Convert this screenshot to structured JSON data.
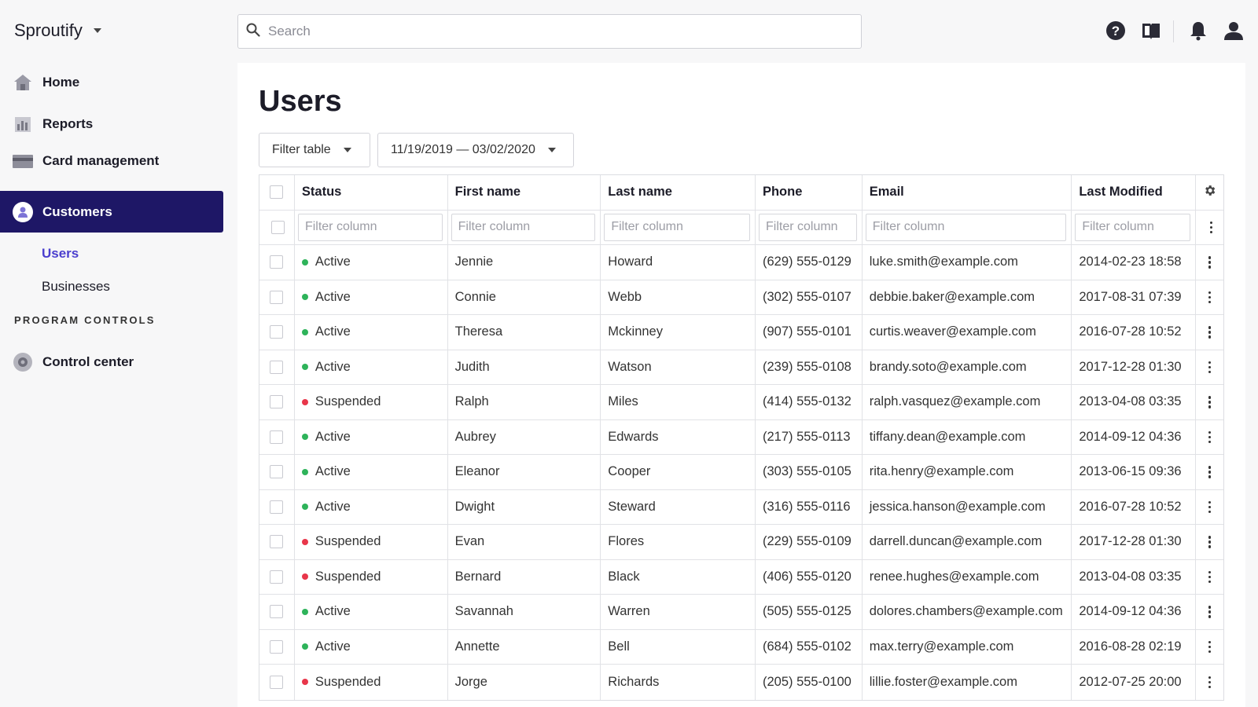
{
  "app": {
    "name": "Sproutify"
  },
  "search": {
    "placeholder": "Search"
  },
  "sidebar": {
    "items": [
      {
        "label": "Home",
        "icon": "home-icon"
      },
      {
        "label": "Reports",
        "icon": "reports-icon"
      },
      {
        "label": "Card management",
        "icon": "card-icon"
      },
      {
        "label": "Customers",
        "icon": "customers-icon",
        "active": true
      }
    ],
    "sub_items": [
      {
        "label": "Users",
        "active": true
      },
      {
        "label": "Businesses"
      }
    ],
    "section_label": "PROGRAM CONTROLS",
    "section_items": [
      {
        "label": "Control center",
        "icon": "gear-icon"
      }
    ]
  },
  "topbar": {
    "icons": [
      "help-icon",
      "book-icon",
      "bell-icon",
      "user-icon"
    ]
  },
  "main": {
    "title": "Users",
    "filter_button": "Filter table",
    "date_range": "11/19/2019 — 03/02/2020",
    "table": {
      "columns": [
        "Status",
        "First name",
        "Last name",
        "Phone",
        "Email",
        "Last Modified"
      ],
      "filter_placeholder": "Filter column",
      "rows": [
        {
          "status": "Active",
          "first": "Jennie",
          "last": "Howard",
          "phone": "(629) 555-0129",
          "email": "luke.smith@example.com",
          "modified": "2014-02-23 18:58"
        },
        {
          "status": "Active",
          "first": "Connie",
          "last": "Webb",
          "phone": "(302) 555-0107",
          "email": "debbie.baker@example.com",
          "modified": "2017-08-31 07:39"
        },
        {
          "status": "Active",
          "first": "Theresa",
          "last": "Mckinney",
          "phone": "(907) 555-0101",
          "email": "curtis.weaver@example.com",
          "modified": "2016-07-28 10:52"
        },
        {
          "status": "Active",
          "first": "Judith",
          "last": "Watson",
          "phone": "(239) 555-0108",
          "email": "brandy.soto@example.com",
          "modified": "2017-12-28 01:30"
        },
        {
          "status": "Suspended",
          "first": "Ralph",
          "last": "Miles",
          "phone": "(414) 555-0132",
          "email": "ralph.vasquez@example.com",
          "modified": "2013-04-08 03:35"
        },
        {
          "status": "Active",
          "first": "Aubrey",
          "last": "Edwards",
          "phone": "(217) 555-0113",
          "email": "tiffany.dean@example.com",
          "modified": "2014-09-12 04:36"
        },
        {
          "status": "Active",
          "first": "Eleanor",
          "last": "Cooper",
          "phone": "(303) 555-0105",
          "email": "rita.henry@example.com",
          "modified": "2013-06-15 09:36"
        },
        {
          "status": "Active",
          "first": "Dwight",
          "last": "Steward",
          "phone": "(316) 555-0116",
          "email": "jessica.hanson@example.com",
          "modified": "2016-07-28 10:52"
        },
        {
          "status": "Suspended",
          "first": "Evan",
          "last": "Flores",
          "phone": "(229) 555-0109",
          "email": "darrell.duncan@example.com",
          "modified": "2017-12-28 01:30"
        },
        {
          "status": "Suspended",
          "first": "Bernard",
          "last": "Black",
          "phone": "(406) 555-0120",
          "email": "renee.hughes@example.com",
          "modified": "2013-04-08 03:35"
        },
        {
          "status": "Active",
          "first": "Savannah",
          "last": "Warren",
          "phone": "(505) 555-0125",
          "email": "dolores.chambers@example.com",
          "modified": "2014-09-12 04:36"
        },
        {
          "status": "Active",
          "first": "Annette",
          "last": "Bell",
          "phone": "(684) 555-0102",
          "email": "max.terry@example.com",
          "modified": "2016-08-28 02:19"
        },
        {
          "status": "Suspended",
          "first": "Jorge",
          "last": "Richards",
          "phone": "(205) 555-0100",
          "email": "lillie.foster@example.com",
          "modified": "2012-07-25 20:00"
        }
      ]
    }
  },
  "colors": {
    "accent": "#1e1766",
    "active_link": "#4b3fce",
    "status_active": "#2eb35a",
    "status_suspended": "#e8364a"
  }
}
